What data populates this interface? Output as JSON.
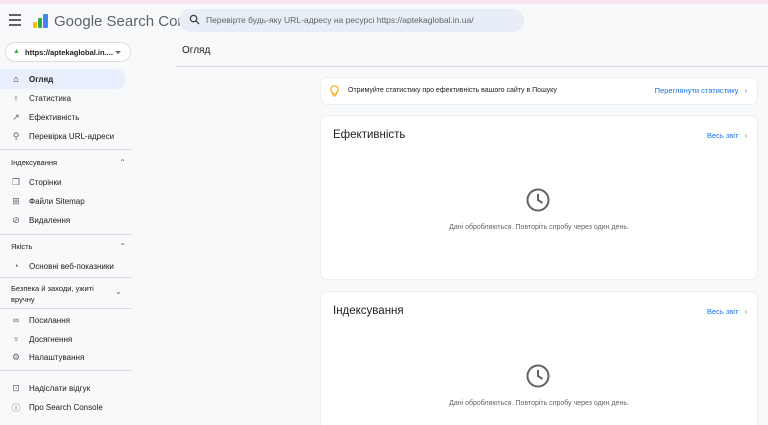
{
  "header": {
    "brand": "Google Search Console",
    "search_placeholder": "Перевірте будь-яку URL-адресу на ресурсі https://aptekaglobal.in.ua/"
  },
  "property": {
    "label": "https://aptekaglobal.in...."
  },
  "sidebar": {
    "items": [
      {
        "label": "Огляд",
        "icon": "home-icon",
        "active": true
      },
      {
        "label": "Статистика",
        "icon": "lightbulb-icon"
      },
      {
        "label": "Ефективність",
        "icon": "trend-icon"
      },
      {
        "label": "Перевірка URL-адреси",
        "icon": "search-icon"
      }
    ],
    "indexing": {
      "title": "Індексування",
      "items": [
        {
          "label": "Сторінки",
          "icon": "pages-icon"
        },
        {
          "label": "Файли Sitemap",
          "icon": "sitemap-icon"
        },
        {
          "label": "Видалення",
          "icon": "removal-icon"
        }
      ]
    },
    "quality": {
      "title": "Якість",
      "items": [
        {
          "label": "Основні веб-показники",
          "icon": "gauge-icon"
        }
      ]
    },
    "security": {
      "title": "Безпека й заходи, ужиті вручну"
    },
    "other_items": [
      {
        "label": "Посилання",
        "icon": "link-icon"
      },
      {
        "label": "Досягнення",
        "icon": "trophy-icon"
      },
      {
        "label": "Налаштування",
        "icon": "gear-icon"
      }
    ],
    "bottom_items": [
      {
        "label": "Надіслати відгук",
        "icon": "feedback-icon"
      },
      {
        "label": "Про Search Console",
        "icon": "info-icon"
      }
    ]
  },
  "main": {
    "page_title": "Огляд",
    "banner": {
      "text": "Отримуйте статистику про ефективність вашого сайту в Пошуку",
      "link": "Переглянути статистику"
    },
    "cards": [
      {
        "title": "Ефективність",
        "link": "Весь звіт",
        "message": "Дані обробляються. Повторіть спробу через один день."
      },
      {
        "title": "Індексування",
        "link": "Весь звіт",
        "message": "Дані обробляються. Повторіть спробу через один день."
      }
    ]
  },
  "colors": {
    "accent": "#1a73e8",
    "active_bg": "#e8f0fe",
    "background": "#f8f9fa"
  }
}
